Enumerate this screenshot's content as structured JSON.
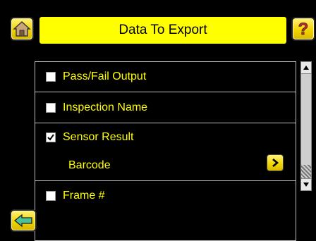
{
  "header": {
    "title": "Data To Export",
    "home_icon": "home-icon",
    "help_icon": "help-icon"
  },
  "options": [
    {
      "label": "Pass/Fail Output",
      "checked": false
    },
    {
      "label": "Inspection Name",
      "checked": false
    },
    {
      "label": "Sensor Result",
      "checked": true
    },
    {
      "label": "Barcode",
      "type": "subitem"
    },
    {
      "label": "Frame #",
      "checked": false
    }
  ],
  "footer": {
    "back_icon": "back-arrow-icon"
  },
  "colors": {
    "background": "#000000",
    "accent": "#ffff00",
    "text": "#ffff00"
  }
}
